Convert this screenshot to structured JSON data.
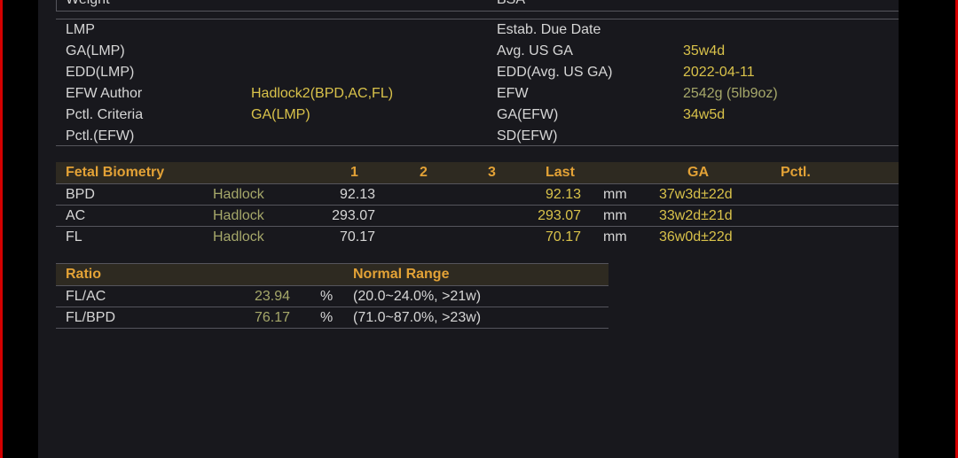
{
  "patient": {
    "weight_label": "Weight",
    "bsa_label": "BSA",
    "left_labels": [
      "LMP",
      "GA(LMP)",
      "EDD(LMP)",
      "EFW Author",
      "Pctl. Criteria",
      "Pctl.(EFW)"
    ],
    "left_values": [
      "",
      "",
      "",
      "Hadlock2(BPD,AC,FL)",
      "GA(LMP)",
      ""
    ],
    "right_labels": [
      "Estab. Due Date",
      "Avg. US GA",
      "EDD(Avg. US GA)",
      "EFW",
      "GA(EFW)",
      "SD(EFW)"
    ],
    "right_values": [
      "",
      "35w4d",
      "2022-04-11",
      "2542g (5lb9oz)",
      "34w5d",
      ""
    ]
  },
  "biometry": {
    "headers": {
      "title": "Fetal Biometry",
      "c1": "1",
      "c2": "2",
      "c3": "3",
      "last": "Last",
      "ga": "GA",
      "pctl": "Pctl."
    },
    "rows": [
      {
        "name": "BPD",
        "author": "Hadlock",
        "v1": "92.13",
        "last": "92.13",
        "unit": "mm",
        "ga": "37w3d±22d"
      },
      {
        "name": "AC",
        "author": "Hadlock",
        "v1": "293.07",
        "last": "293.07",
        "unit": "mm",
        "ga": "33w2d±21d"
      },
      {
        "name": "FL",
        "author": "Hadlock",
        "v1": "70.17",
        "last": "70.17",
        "unit": "mm",
        "ga": "36w0d±22d"
      }
    ]
  },
  "ratio": {
    "headers": {
      "title": "Ratio",
      "range": "Normal Range"
    },
    "rows": [
      {
        "name": "FL/AC",
        "value": "23.94",
        "unit": "%",
        "range": "(20.0~24.0%, >21w)"
      },
      {
        "name": "FL/BPD",
        "value": "76.17",
        "unit": "%",
        "range": "(71.0~87.0%, >23w)"
      }
    ]
  },
  "colors": {
    "accent_orange": "#e3a236",
    "value_yellow": "#d9c24a",
    "author_olive": "#a6a86a",
    "border_red": "#d40000"
  }
}
